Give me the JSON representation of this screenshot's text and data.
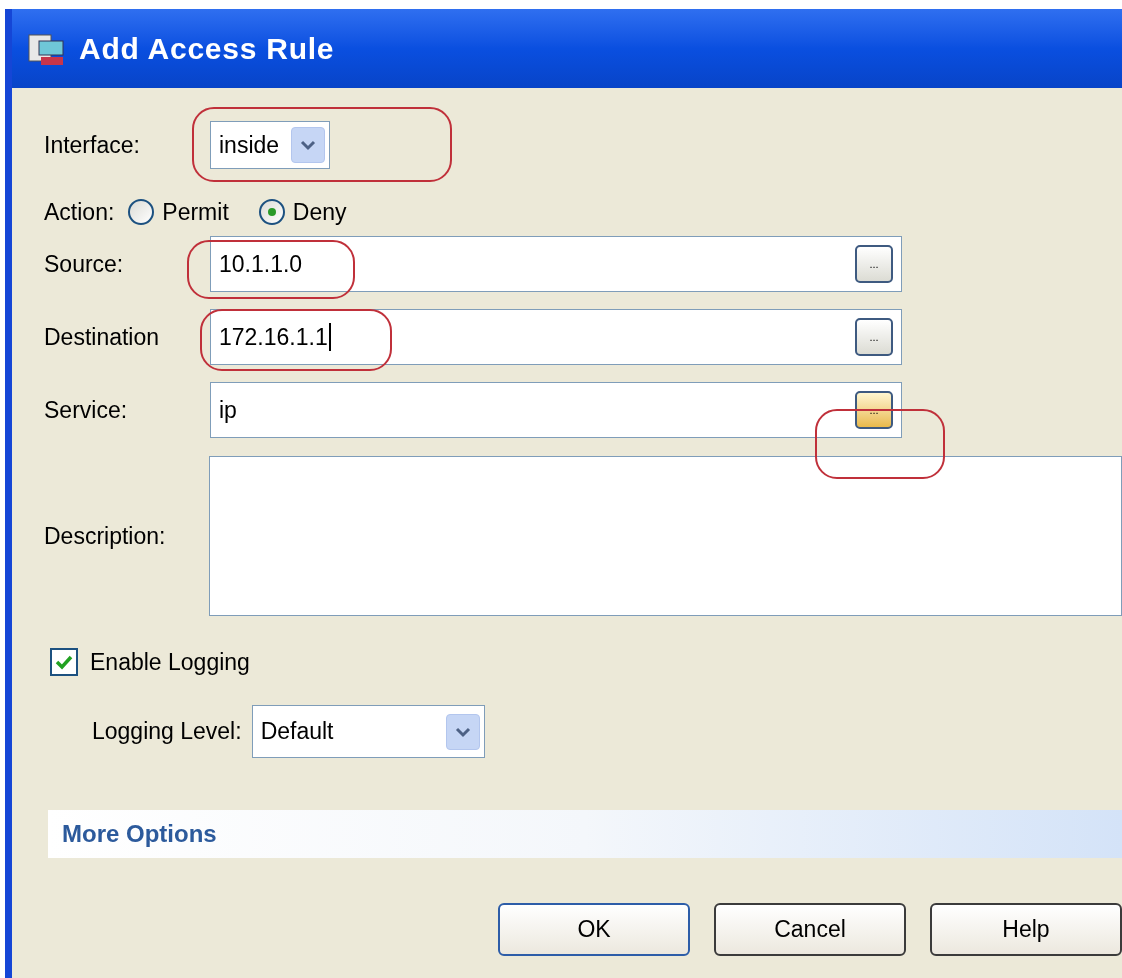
{
  "window": {
    "title": "Add Access Rule"
  },
  "interface": {
    "label": "Interface:",
    "value": "inside",
    "highlighted": true
  },
  "action": {
    "label": "Action:",
    "options": [
      {
        "label": "Permit",
        "selected": false
      },
      {
        "label": "Deny",
        "selected": true
      }
    ]
  },
  "fields": [
    {
      "label": "Source:",
      "value": "10.1.1.0",
      "browse": "...",
      "highlighted": true,
      "focused": false,
      "browse_highlighted": false,
      "browse_hover": false
    },
    {
      "label": "Destination",
      "value": "172.16.1.1",
      "browse": "...",
      "highlighted": true,
      "focused": true,
      "browse_highlighted": false,
      "browse_hover": false
    },
    {
      "label": "Service:",
      "value": "ip",
      "browse": "...",
      "highlighted": false,
      "focused": false,
      "browse_highlighted": true,
      "browse_hover": true
    }
  ],
  "description": {
    "label": "Description:"
  },
  "logging": {
    "label": "Enable Logging",
    "checked": true,
    "level_label": "Logging Level:",
    "level_value": "Default"
  },
  "more_options": {
    "label": "More Options"
  },
  "buttons": [
    "OK",
    "Cancel",
    "Help"
  ]
}
